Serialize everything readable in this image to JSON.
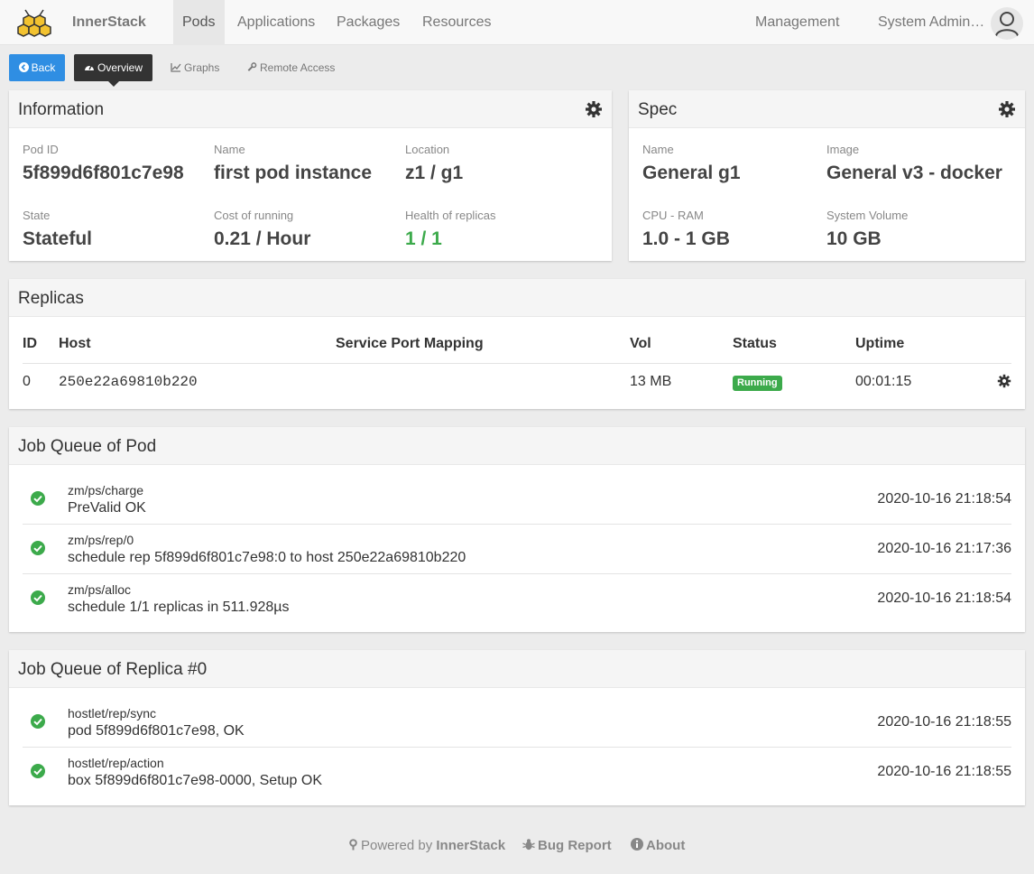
{
  "nav": {
    "brand": "InnerStack",
    "items": [
      "Pods",
      "Applications",
      "Packages",
      "Resources"
    ],
    "active": "Pods",
    "management": "Management",
    "user": "System Admin…"
  },
  "toolbar": {
    "back": "Back",
    "overview": "Overview",
    "graphs": "Graphs",
    "remote": "Remote Access"
  },
  "info": {
    "title": "Information",
    "fields": [
      {
        "label": "Pod ID",
        "value": "5f899d6f801c7e98"
      },
      {
        "label": "Name",
        "value": "first pod instance"
      },
      {
        "label": "Location",
        "value": "z1 / g1"
      },
      {
        "label": "State",
        "value": "Stateful"
      },
      {
        "label": "Cost of running",
        "value": "0.21 / Hour"
      },
      {
        "label": "Health of replicas",
        "value": "1 / 1"
      }
    ]
  },
  "spec": {
    "title": "Spec",
    "fields": [
      {
        "label": "Name",
        "value": "General g1"
      },
      {
        "label": "Image",
        "value": "General v3 - docker"
      },
      {
        "label": "CPU - RAM",
        "value": "1.0 - 1 GB"
      },
      {
        "label": "System Volume",
        "value": "10 GB"
      }
    ]
  },
  "replicas": {
    "title": "Replicas",
    "columns": [
      "ID",
      "Host",
      "Service Port Mapping",
      "Vol",
      "Status",
      "Uptime"
    ],
    "rows": [
      {
        "id": "0",
        "host": "250e22a69810b220",
        "ports": "",
        "vol": "13 MB",
        "status": "Running",
        "uptime": "00:01:15"
      }
    ]
  },
  "pod_jobs": {
    "title": "Job Queue of Pod",
    "items": [
      {
        "name": "zm/ps/charge",
        "msg": "PreValid OK",
        "time": "2020-10-16 21:18:54"
      },
      {
        "name": "zm/ps/rep/0",
        "msg": "schedule rep 5f899d6f801c7e98:0 to host 250e22a69810b220",
        "time": "2020-10-16 21:17:36"
      },
      {
        "name": "zm/ps/alloc",
        "msg": "schedule 1/1 replicas in 511.928µs",
        "time": "2020-10-16 21:18:54"
      }
    ]
  },
  "replica_jobs": {
    "title": "Job Queue of Replica #0",
    "items": [
      {
        "name": "hostlet/rep/sync",
        "msg": "pod 5f899d6f801c7e98, OK",
        "time": "2020-10-16 21:18:55"
      },
      {
        "name": "hostlet/rep/action",
        "msg": "box 5f899d6f801c7e98-0000, Setup OK",
        "time": "2020-10-16 21:18:55"
      }
    ]
  },
  "footer": {
    "powered_prefix": "Powered by",
    "powered_brand": "InnerStack",
    "bug": "Bug Report",
    "about": "About"
  },
  "colors": {
    "primary": "#2f8ee3",
    "success": "#3caa4b",
    "dark": "#333333"
  }
}
